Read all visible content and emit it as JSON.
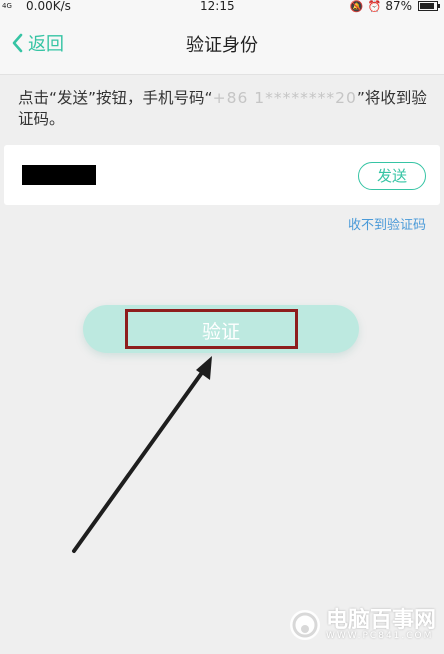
{
  "status_bar": {
    "network_speed": "0.00K/s",
    "time": "12:15",
    "battery_text": "87%",
    "battery_level": 0.87,
    "signal_label": "4G"
  },
  "nav": {
    "back_label": "返回",
    "title": "验证身份"
  },
  "instruction": {
    "prefix": "点击“发送”按钮，手机号码“",
    "masked_phone": "+86 1********20",
    "suffix": "”将收到验证码。"
  },
  "code_entry": {
    "send_label": "发送",
    "not_received_label": "收不到验证码"
  },
  "verify": {
    "label": "验证"
  },
  "watermark": {
    "title": "电脑百事网",
    "url": "WWW.PC841.COM"
  },
  "colors": {
    "accent": "#36c4a4",
    "verify_button_bg": "#bde9e0",
    "highlight_border": "#8e1d1d",
    "link": "#4a9ad8"
  }
}
